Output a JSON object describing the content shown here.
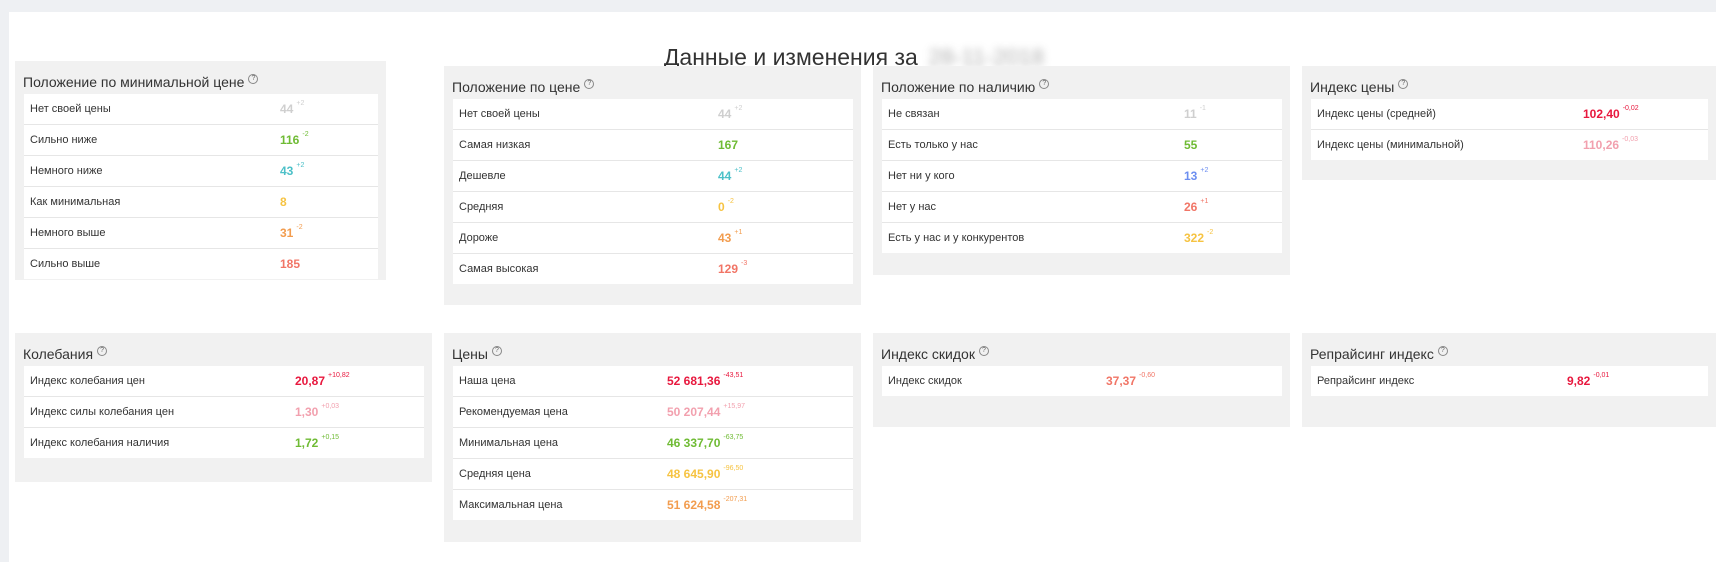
{
  "header": {
    "title": "Данные и изменения за",
    "date_blurred": "28-11-2018"
  },
  "panels": {
    "p1": {
      "title": "Положение по минимальной цене",
      "rows": [
        {
          "label": "Нет своей цены",
          "value": "44",
          "delta": "+2"
        },
        {
          "label": "Сильно ниже",
          "value": "116",
          "delta": "-2"
        },
        {
          "label": "Немного ниже",
          "value": "43",
          "delta": "+2"
        },
        {
          "label": "Как минимальная",
          "value": "8",
          "delta": ""
        },
        {
          "label": "Немного выше",
          "value": "31",
          "delta": "-2"
        },
        {
          "label": "Сильно выше",
          "value": "185",
          "delta": ""
        }
      ]
    },
    "p2": {
      "title": "Положение по цене",
      "rows": [
        {
          "label": "Нет своей цены",
          "value": "44",
          "delta": "+2"
        },
        {
          "label": "Самая низкая",
          "value": "167",
          "delta": ""
        },
        {
          "label": "Дешевле",
          "value": "44",
          "delta": "+2"
        },
        {
          "label": "Средняя",
          "value": "0",
          "delta": "-2"
        },
        {
          "label": "Дороже",
          "value": "43",
          "delta": "+1"
        },
        {
          "label": "Самая высокая",
          "value": "129",
          "delta": "-3"
        }
      ]
    },
    "p3": {
      "title": "Положение по наличию",
      "rows": [
        {
          "label": "Не связан",
          "value": "11",
          "delta": "-1"
        },
        {
          "label": "Есть только у нас",
          "value": "55",
          "delta": ""
        },
        {
          "label": "Нет ни у кого",
          "value": "13",
          "delta": "+2"
        },
        {
          "label": "Нет у нас",
          "value": "26",
          "delta": "+1"
        },
        {
          "label": "Есть у нас и у конкурентов",
          "value": "322",
          "delta": "-2"
        }
      ]
    },
    "p4": {
      "title": "Индекс цены",
      "rows": [
        {
          "label": "Индекс цены (средней)",
          "value": "102,40",
          "delta": "-0,02"
        },
        {
          "label": "Индекс цены (минимальной)",
          "value": "110,26",
          "delta": "-0,03"
        }
      ]
    },
    "p5": {
      "title": "Колебания",
      "rows": [
        {
          "label": "Индекс колебания цен",
          "value": "20,87",
          "delta": "+10,82"
        },
        {
          "label": "Индекс силы колебания цен",
          "value": "1,30",
          "delta": "+0,03"
        },
        {
          "label": "Индекс колебания наличия",
          "value": "1,72",
          "delta": "+0,15"
        }
      ]
    },
    "p6": {
      "title": "Цены",
      "rows": [
        {
          "label": "Наша цена",
          "value": "52 681,36",
          "delta": "-43,51"
        },
        {
          "label": "Рекомендуемая цена",
          "value": "50 207,44",
          "delta": "+15,97"
        },
        {
          "label": "Минимальная цена",
          "value": "46 337,70",
          "delta": "-63,75"
        },
        {
          "label": "Средняя цена",
          "value": "48 645,90",
          "delta": "-96,50"
        },
        {
          "label": "Максимальная цена",
          "value": "51 624,58",
          "delta": "-207,31"
        }
      ]
    },
    "p7": {
      "title": "Индекс скидок",
      "rows": [
        {
          "label": "Индекс скидок",
          "value": "37,37",
          "delta": "-0,60"
        }
      ]
    },
    "p8": {
      "title": "Репрайсинг индекс",
      "rows": [
        {
          "label": "Репрайсинг индекс",
          "value": "9,82",
          "delta": "-0,01"
        }
      ]
    }
  },
  "colors": {
    "gray": "#cfcfcf",
    "green": "#6fbb34",
    "teal": "#4cc0c8",
    "yellow": "#f6c342",
    "orange": "#f29c4e",
    "salmon": "#f17566",
    "blue": "#6c8ef0",
    "red": "#e8183e",
    "pink": "#f2a0ae"
  },
  "icons": {
    "help": "?"
  }
}
